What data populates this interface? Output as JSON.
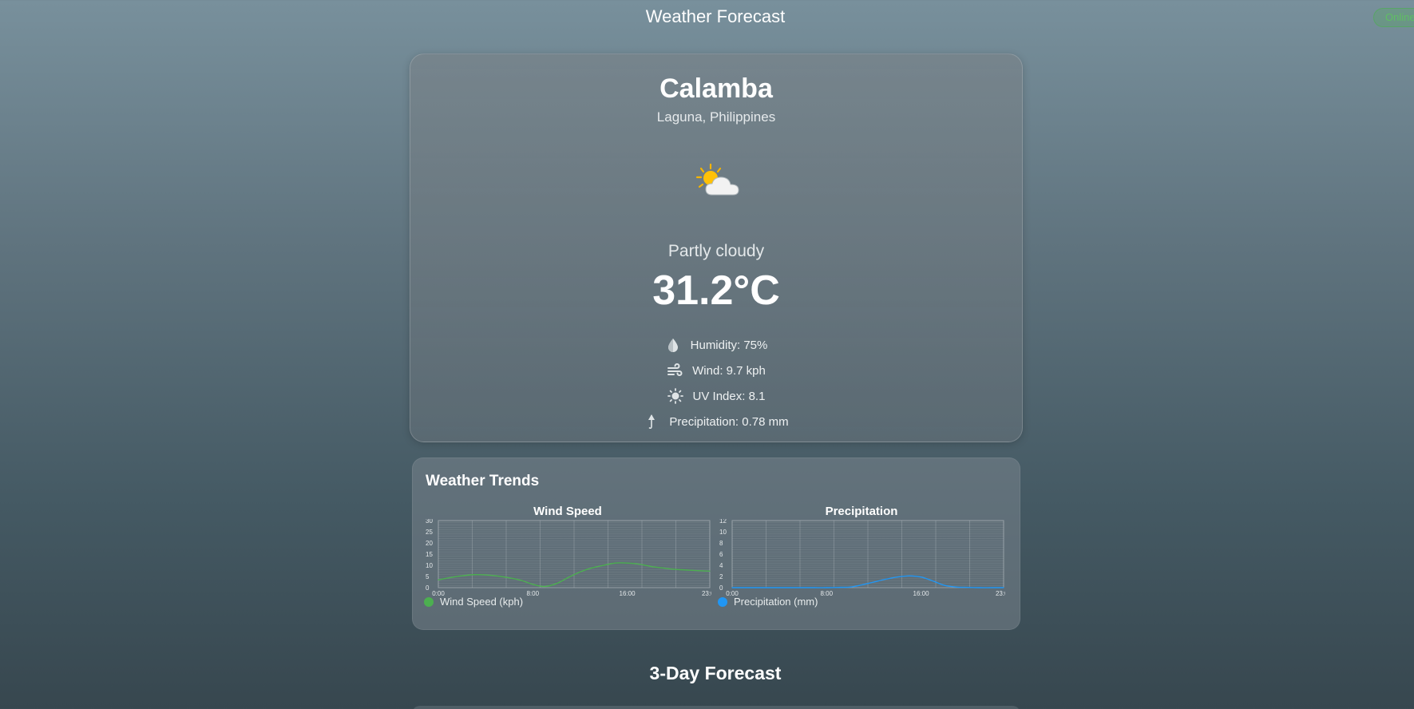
{
  "app": {
    "title": "Weather Forecast",
    "status_label": "Online"
  },
  "current": {
    "city": "Calamba",
    "region": "Laguna, Philippines",
    "condition_icon": "partly-cloudy-icon",
    "condition": "Partly cloudy",
    "temperature": "31.2°C",
    "details": {
      "humidity": "Humidity: 75%",
      "wind": "Wind: 9.7 kph",
      "uv": "UV Index: 8.1",
      "precipitation": "Precipitation: 0.78 mm"
    }
  },
  "trends": {
    "title": "Weather Trends",
    "wind_chart": {
      "title": "Wind Speed",
      "legend": "Wind Speed (kph)",
      "color": "#4caf50"
    },
    "precip_chart": {
      "title": "Precipitation",
      "legend": "Precipitation (mm)",
      "color": "#2196f3"
    }
  },
  "forecast": {
    "title": "3-Day Forecast"
  },
  "chart_data": [
    {
      "type": "line",
      "title": "Wind Speed",
      "x": [
        "0:00",
        "1:00",
        "2:00",
        "3:00",
        "4:00",
        "5:00",
        "6:00",
        "7:00",
        "8:00",
        "9:00",
        "10:00",
        "11:00",
        "12:00",
        "13:00",
        "14:00",
        "15:00",
        "16:00",
        "17:00",
        "18:00",
        "19:00",
        "20:00",
        "21:00",
        "22:00",
        "23:00"
      ],
      "x_tick_labels": [
        "0:00",
        "8:00",
        "16:00",
        "23:00"
      ],
      "series": [
        {
          "name": "Wind Speed (kph)",
          "values": [
            3.5,
            4.5,
            5.3,
            5.8,
            5.7,
            5.2,
            4.4,
            3.3,
            1.5,
            0.5,
            1.8,
            4.5,
            7.0,
            8.8,
            10.0,
            11.0,
            11.0,
            10.5,
            9.5,
            8.8,
            8.2,
            7.9,
            7.6,
            7.4
          ]
        }
      ],
      "y_ticks": [
        0,
        5,
        10,
        15,
        20,
        25,
        30
      ],
      "ylim": [
        0,
        30
      ],
      "grid": true,
      "legend": "bottom-left"
    },
    {
      "type": "line",
      "title": "Precipitation",
      "x": [
        "0:00",
        "1:00",
        "2:00",
        "3:00",
        "4:00",
        "5:00",
        "6:00",
        "7:00",
        "8:00",
        "9:00",
        "10:00",
        "11:00",
        "12:00",
        "13:00",
        "14:00",
        "15:00",
        "16:00",
        "17:00",
        "18:00",
        "19:00",
        "20:00",
        "21:00",
        "22:00",
        "23:00"
      ],
      "x_tick_labels": [
        "0:00",
        "8:00",
        "16:00",
        "23:00"
      ],
      "series": [
        {
          "name": "Precipitation (mm)",
          "values": [
            0,
            0,
            0,
            0,
            0,
            0,
            0,
            0,
            0,
            0.05,
            0.1,
            0.5,
            1.0,
            1.5,
            1.9,
            2.1,
            1.9,
            1.2,
            0.4,
            0.1,
            0.05,
            0,
            0,
            0
          ]
        }
      ],
      "y_ticks": [
        0,
        2,
        4,
        6,
        8,
        10,
        12
      ],
      "ylim": [
        0,
        12
      ],
      "grid": true,
      "legend": "bottom-left"
    }
  ]
}
